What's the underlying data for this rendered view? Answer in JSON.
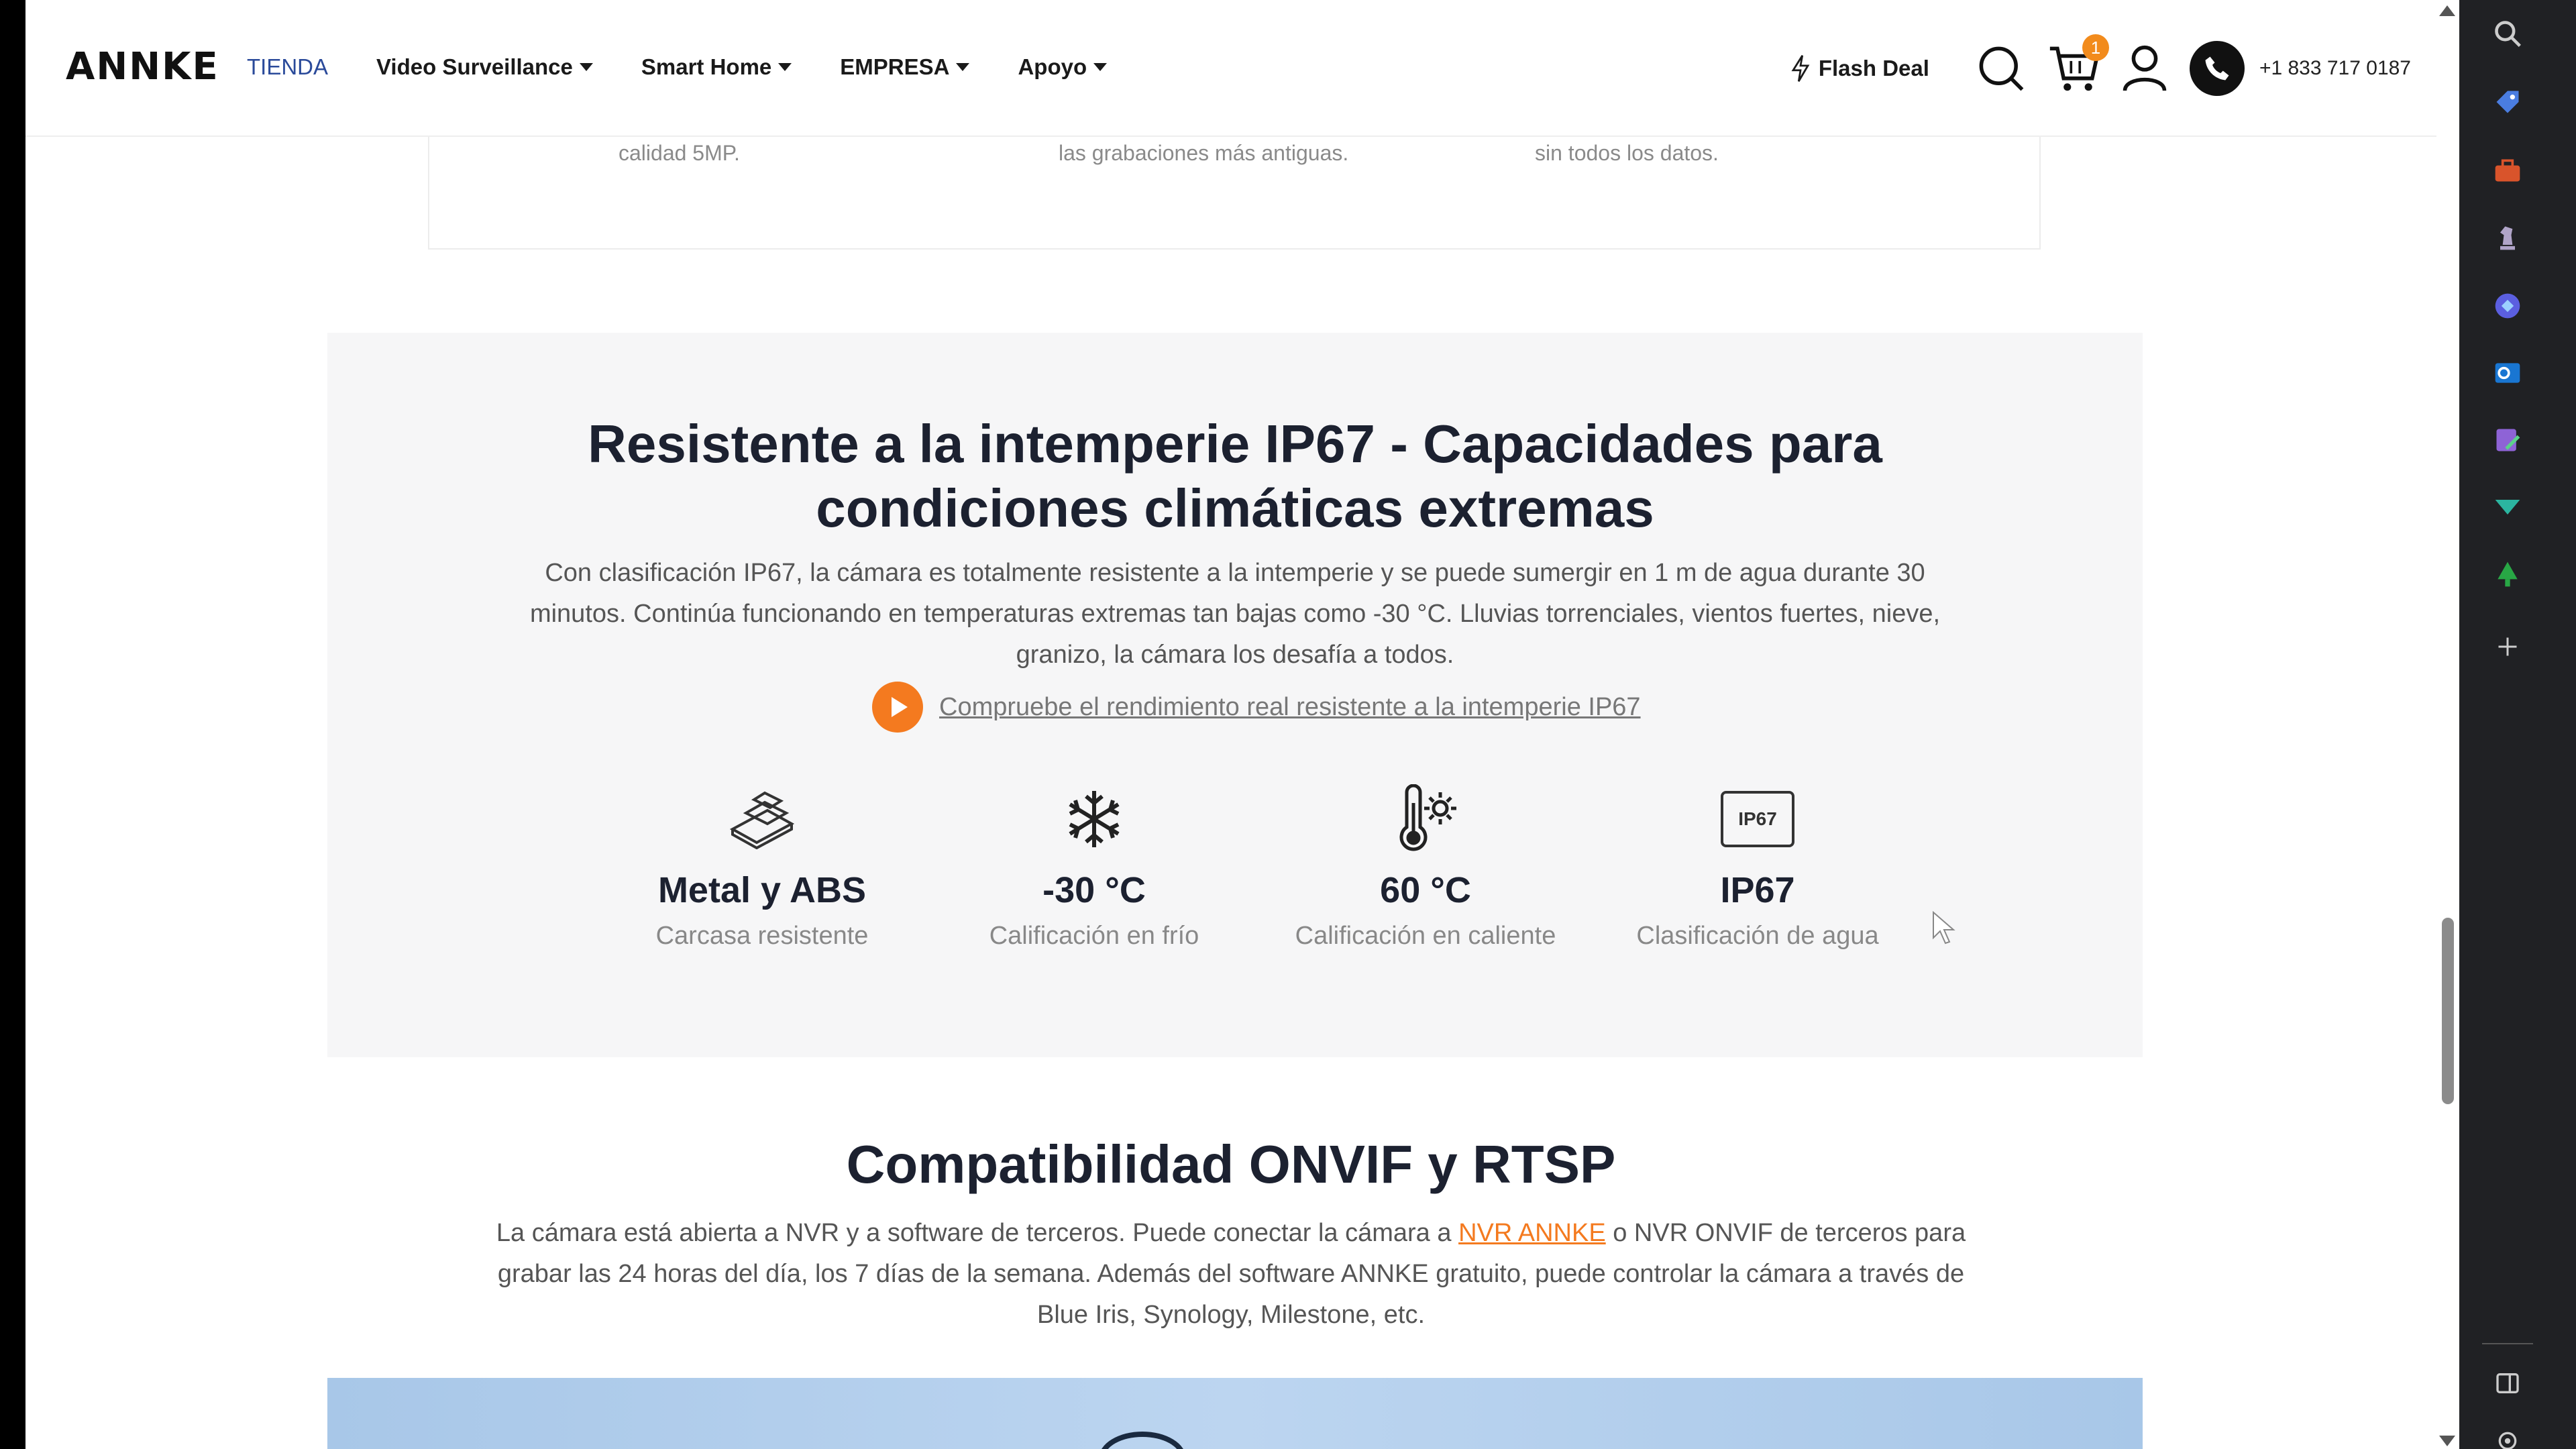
{
  "header": {
    "logo": "ANNKE",
    "nav": [
      {
        "label": "TIENDA",
        "active": true,
        "dropdown": false
      },
      {
        "label": "Video Surveillance",
        "dropdown": true
      },
      {
        "label": "Smart Home",
        "dropdown": true
      },
      {
        "label": "EMPRESA",
        "dropdown": true
      },
      {
        "label": "Apoyo",
        "dropdown": true
      }
    ],
    "flash_deal": "Flash Deal",
    "cart_count": "1",
    "phone": "+1 833 717 0187"
  },
  "prev_section": {
    "texts": [
      "calidad 5MP.",
      "las grabaciones más antiguas.",
      "sin todos los datos."
    ]
  },
  "weather": {
    "title": "Resistente a la intemperie IP67 - Capacidades para condiciones climáticas extremas",
    "description": "Con clasificación IP67, la cámara es totalmente resistente a la intemperie y se puede sumergir en 1 m de agua durante 30 minutos. Continúa funcionando en temperaturas extremas tan bajas como -30 °C. Lluvias torrenciales, vientos fuertes, nieve, granizo, la cámara los desafía a todos.",
    "link": "Compruebe el rendimiento real resistente a la intemperie IP67",
    "features": [
      {
        "icon": "metal-bars-icon",
        "value": "Metal y ABS",
        "label": "Carcasa resistente"
      },
      {
        "icon": "snowflake-icon",
        "value": "-30 °C",
        "label": "Calificación en frío"
      },
      {
        "icon": "thermometer-sun-icon",
        "value": "60 °C",
        "label": "Calificación en caliente"
      },
      {
        "icon": "ip67-badge-icon",
        "value": "IP67",
        "label": "Clasificación de agua",
        "badge": "IP67"
      }
    ]
  },
  "onvif": {
    "title": "Compatibilidad ONVIF y RTSP",
    "desc_before": "La cámara está abierta a NVR y a software de terceros. Puede conectar la cámara a ",
    "desc_link": "NVR ANNKE",
    "desc_after": " o NVR ONVIF de terceros para grabar las 24 horas del día, los 7 días de la semana. Además del software ANNKE gratuito, puede controlar la cámara a través de Blue Iris, Synology, Milestone, etc."
  },
  "colors": {
    "accent": "#f47a1f",
    "nav_active": "#2a4a9a",
    "section_bg": "#f6f6f7"
  }
}
